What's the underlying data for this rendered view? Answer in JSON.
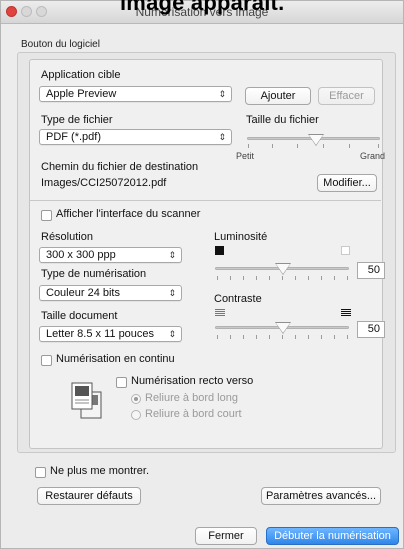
{
  "clipped_heading": "image apparaît.",
  "window": {
    "title": "Numérisation vers image"
  },
  "group_label": "Bouton du logiciel",
  "target_app": {
    "label": "Application cible",
    "value": "Apple Preview",
    "add_button": "Ajouter",
    "delete_button": "Effacer"
  },
  "file_type": {
    "label": "Type de fichier",
    "value": "PDF (*.pdf)"
  },
  "file_size": {
    "label": "Taille du fichier",
    "min_label": "Petit",
    "max_label": "Grand",
    "level": 0.55
  },
  "destination": {
    "label": "Chemin du fichier de destination",
    "path": "Images/CCI25072012.pdf",
    "modify_button": "Modifier..."
  },
  "show_scanner_interface": {
    "label": "Afficher l'interface du scanner",
    "checked": false
  },
  "resolution": {
    "label": "Résolution",
    "value": "300 x 300 ppp"
  },
  "scan_type": {
    "label": "Type de numérisation",
    "value": "Couleur 24 bits"
  },
  "document_size": {
    "label": "Taille document",
    "value": "Letter 8.5 x 11 pouces"
  },
  "brightness": {
    "label": "Luminosité",
    "value": "50"
  },
  "contrast": {
    "label": "Contraste",
    "value": "50"
  },
  "continuous_scan": {
    "label": "Numérisation en continu",
    "checked": false
  },
  "duplex": {
    "label": "Numérisation recto verso",
    "checked": false,
    "options": [
      "Reliure à bord long",
      "Reliure à bord court"
    ],
    "selected_index": 0
  },
  "dont_show": {
    "label": "Ne plus me montrer.",
    "checked": false
  },
  "buttons": {
    "restore": "Restaurer défauts",
    "advanced": "Paramètres avancés...",
    "close": "Fermer",
    "start": "Débuter la numérisation"
  },
  "colors": {
    "default_button": "#2f86ea",
    "close_light": "#e0443e"
  }
}
